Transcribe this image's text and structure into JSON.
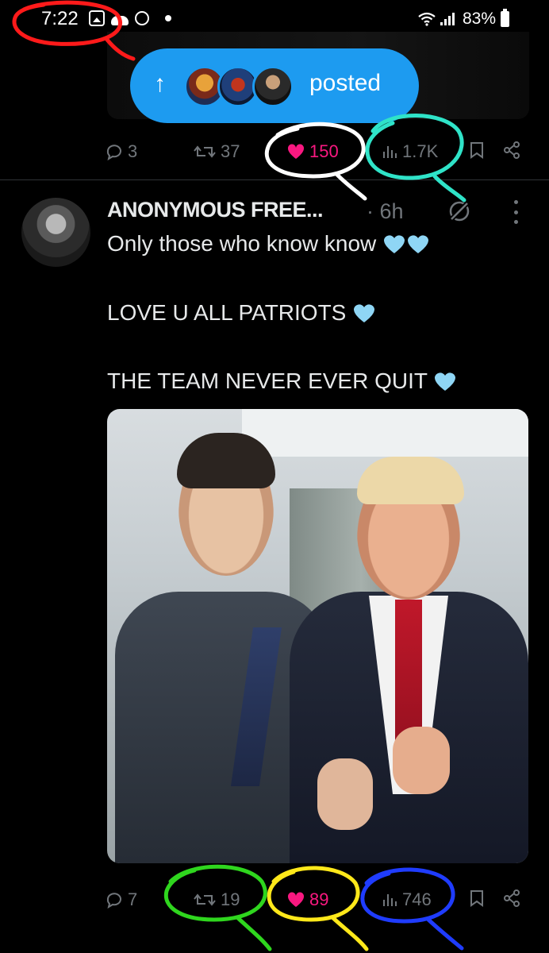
{
  "status_bar": {
    "time": "7:22",
    "battery": "83%",
    "icons": [
      "gallery-icon",
      "cloud-icon",
      "messenger-icon",
      "dot-icon",
      "wifi-icon",
      "signal-icon",
      "battery-icon"
    ]
  },
  "new_posts_pill": {
    "label": "posted",
    "avatars": [
      "avatar-1",
      "avatar-2",
      "avatar-3"
    ]
  },
  "prev_post_actions": {
    "replies": "3",
    "reposts": "37",
    "likes": "150",
    "views": "1.7K"
  },
  "tweet": {
    "author": "ANONYMOUS FREE...",
    "time": "· 6h",
    "lines": [
      "Only those who know know",
      "LOVE U ALL PATRIOTS",
      "THE TEAM NEVER EVER QUIT"
    ],
    "actions": {
      "replies": "7",
      "reposts": "19",
      "likes": "89",
      "views": "746"
    }
  },
  "colors": {
    "background": "#000000",
    "accent": "#1d9bf0",
    "like": "#f91880",
    "muted": "#71767b",
    "heart_emoji": "#8fd6f5",
    "annotation_red": "#ff1a1a",
    "annotation_white": "#ffffff",
    "annotation_teal": "#2fe3c8",
    "annotation_green": "#2fd61e",
    "annotation_yellow": "#ffe81a",
    "annotation_blue": "#1f3cff"
  }
}
